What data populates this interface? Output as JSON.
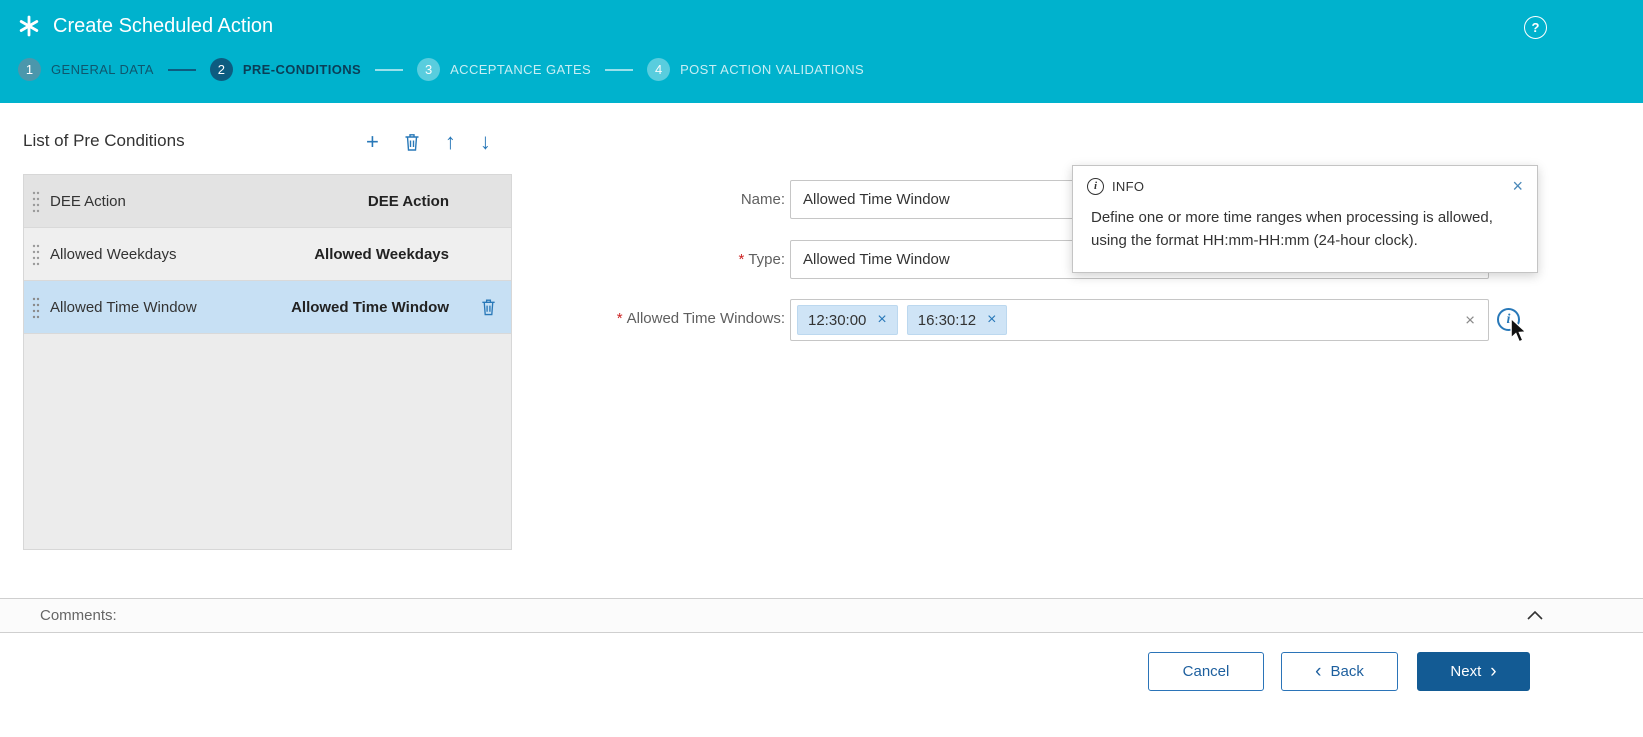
{
  "colors": {
    "header_bg": "#00b2cd",
    "accent_blue": "#2878b8",
    "primary_button": "#135b94",
    "selected_row": "#c7e0f4",
    "chip_bg": "#cfe4f6",
    "required_red": "#cc2222"
  },
  "header": {
    "title": "Create Scheduled Action",
    "help_glyph": "?"
  },
  "wizard": {
    "steps": [
      {
        "num": "1",
        "label": "GENERAL DATA",
        "state": "completed"
      },
      {
        "num": "2",
        "label": "PRE-CONDITIONS",
        "state": "active"
      },
      {
        "num": "3",
        "label": "ACCEPTANCE GATES",
        "state": "upcoming"
      },
      {
        "num": "4",
        "label": "POST ACTION VALIDATIONS",
        "state": "upcoming"
      }
    ]
  },
  "list": {
    "title": "List of Pre Conditions",
    "rows": [
      {
        "name": "DEE Action",
        "type": "DEE Action"
      },
      {
        "name": "Allowed Weekdays",
        "type": "Allowed Weekdays"
      },
      {
        "name": "Allowed Time Window",
        "type": "Allowed Time Window"
      }
    ],
    "selected_row": "Allowed Time Window"
  },
  "form": {
    "required_marker": "*",
    "name": {
      "label": "Name:",
      "value": "Allowed Time Window"
    },
    "type": {
      "label": "Type:",
      "value": "Allowed Time Window"
    },
    "windows": {
      "label": "Allowed Time Windows:",
      "chips": [
        "12:30:00",
        "16:30:12"
      ]
    }
  },
  "tooltip": {
    "title": "INFO",
    "body": "Define one or more time ranges when processing is allowed, using the format HH:mm-HH:mm (24-hour clock)."
  },
  "comments": {
    "label": "Comments:"
  },
  "footer": {
    "cancel_label": "Cancel",
    "back_label": "Back",
    "next_label": "Next"
  },
  "icons": {
    "add": "+",
    "move_up": "↑",
    "move_down": "↓",
    "close": "×",
    "back_chevron": "‹",
    "next_chevron": "›",
    "info": "i"
  }
}
